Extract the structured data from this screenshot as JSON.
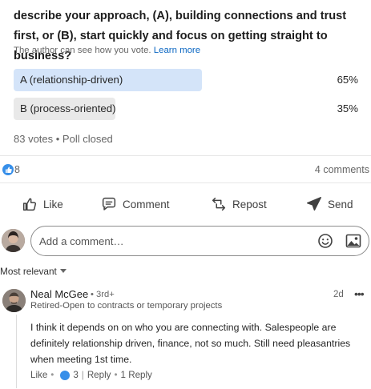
{
  "poll": {
    "question": "describe your approach, (A), building connections and trust first, or (B), start quickly and focus on getting straight to business?",
    "note": "The author can see how you vote.",
    "learn_more": "Learn more",
    "options": [
      {
        "label": "A (relationship-driven)",
        "percent": "65%",
        "fraction": 0.65,
        "selected": true
      },
      {
        "label": "B (process-oriented)",
        "percent": "35%",
        "fraction": 0.35,
        "selected": false
      }
    ],
    "votes_text": "83 votes • Poll closed"
  },
  "social": {
    "reaction_count": "8",
    "comments_text": "4 comments"
  },
  "actions": {
    "like": "Like",
    "comment": "Comment",
    "repost": "Repost",
    "send": "Send"
  },
  "comment_box": {
    "placeholder": "Add a comment…"
  },
  "sort": {
    "label": "Most relevant"
  },
  "comment": {
    "author": "Neal McGee",
    "degree": "• 3rd+",
    "headline": "Retired-Open to contracts or temporary projects",
    "time": "2d",
    "more": "•••",
    "body": "I think it depends on on who you are connecting with. Salespeople are definitely relationship driven, finance, not so much. Still need pleasantries when meeting 1st time.",
    "like_label": "Like",
    "like_count": "3",
    "reply_label": "Reply",
    "replies_text": "1 Reply"
  },
  "colors": {
    "accent": "#0a66c2",
    "option_selected": "#d4e4f9",
    "option_other": "#e9e9e9",
    "like_blue": "#378fe9"
  }
}
